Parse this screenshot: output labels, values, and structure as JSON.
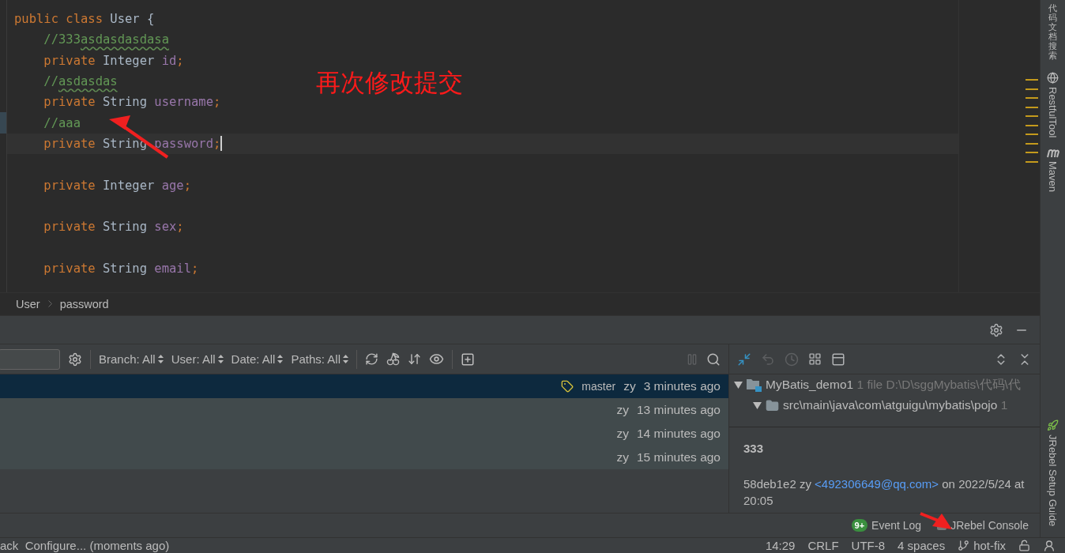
{
  "editor": {
    "lines": [
      {
        "tokens": [
          {
            "text": "public class ",
            "kind": "keyword"
          },
          {
            "text": "User {",
            "kind": "plain"
          }
        ],
        "current": false,
        "changed": false
      },
      {
        "tokens": [
          {
            "text": "    //333",
            "kind": "comment"
          },
          {
            "text": "asdasdasdasa",
            "kind": "typo"
          }
        ],
        "current": false,
        "changed": false
      },
      {
        "tokens": [
          {
            "text": "    private ",
            "kind": "keyword"
          },
          {
            "text": "Integer ",
            "kind": "plain"
          },
          {
            "text": "id",
            "kind": "field"
          },
          {
            "text": ";",
            "kind": "keyword"
          }
        ],
        "current": false,
        "changed": false
      },
      {
        "tokens": [
          {
            "text": "    //",
            "kind": "comment"
          },
          {
            "text": "asdasdas",
            "kind": "typo"
          }
        ],
        "current": false,
        "changed": false
      },
      {
        "tokens": [
          {
            "text": "    private ",
            "kind": "keyword"
          },
          {
            "text": "String ",
            "kind": "plain"
          },
          {
            "text": "username",
            "kind": "field"
          },
          {
            "text": ";",
            "kind": "keyword"
          }
        ],
        "current": false,
        "changed": false
      },
      {
        "tokens": [
          {
            "text": "    //aaa",
            "kind": "comment"
          }
        ],
        "current": false,
        "changed": true
      },
      {
        "tokens": [
          {
            "text": "    private ",
            "kind": "keyword"
          },
          {
            "text": "String ",
            "kind": "plain"
          },
          {
            "text": "password",
            "kind": "field"
          },
          {
            "text": ";",
            "kind": "keyword"
          }
        ],
        "current": true,
        "changed": false
      },
      {
        "current": false,
        "changed": false
      },
      {
        "tokens": [
          {
            "text": "    private ",
            "kind": "keyword"
          },
          {
            "text": "Integer ",
            "kind": "plain"
          },
          {
            "text": "age",
            "kind": "field"
          },
          {
            "text": ";",
            "kind": "keyword"
          }
        ],
        "current": false,
        "changed": false
      },
      {
        "current": false,
        "changed": false
      },
      {
        "tokens": [
          {
            "text": "    private ",
            "kind": "keyword"
          },
          {
            "text": "String ",
            "kind": "plain"
          },
          {
            "text": "sex",
            "kind": "field"
          },
          {
            "text": ";",
            "kind": "keyword"
          }
        ],
        "current": false,
        "changed": false
      },
      {
        "current": false,
        "changed": false
      },
      {
        "tokens": [
          {
            "text": "    private ",
            "kind": "keyword"
          },
          {
            "text": "String ",
            "kind": "plain"
          },
          {
            "text": "email",
            "kind": "field"
          },
          {
            "text": ";",
            "kind": "keyword"
          }
        ],
        "current": false,
        "changed": false
      }
    ]
  },
  "annotation": "再次修改提交",
  "breadcrumb": [
    "User",
    "password"
  ],
  "log_filters": [
    "Branch: All",
    "User: All",
    "Date: All",
    "Paths: All"
  ],
  "commits": [
    {
      "branch": "master",
      "author": "zy",
      "date": "3 minutes ago",
      "selected": true
    },
    {
      "author": "zy",
      "date": "13 minutes ago",
      "selected": false
    },
    {
      "author": "zy",
      "date": "14 minutes ago",
      "selected": false
    },
    {
      "author": "zy",
      "date": "15 minutes ago",
      "selected": false
    }
  ],
  "changes_tree": [
    {
      "name": "MyBatis_demo1",
      "detail": "1 file  D:\\D\\sggMybatis\\代码\\代",
      "kind": "module",
      "children": [
        {
          "name": "src\\main\\java\\com\\atguigu\\mybatis\\pojo",
          "detail": "1",
          "kind": "folder"
        }
      ]
    }
  ],
  "commit_details": {
    "message": "333",
    "prefix": "58deb1e2 zy",
    "email": "<492306649@qq.com>",
    "suffix": "on 2022/5/24 at 20:05"
  },
  "tool_buttons": [
    {
      "label": "Event Log",
      "badge": "9+",
      "kind": "log"
    },
    {
      "label": "JRebel Console",
      "kind": "jrebel"
    }
  ],
  "status_bar": {
    "message": "ack  Configure... (moments ago)",
    "items": [
      "14:29",
      "CRLF",
      "UTF-8",
      "4 spaces"
    ],
    "branch": "hot-fix"
  },
  "right_stripe": {
    "top": [
      {
        "label": "代码文档搜索",
        "kind": "cjk"
      },
      {
        "label": "RestfulTool",
        "kind": "globe"
      },
      {
        "label": "Maven",
        "kind": "maven"
      }
    ],
    "bottom": [
      {
        "label": "JRebel Setup Guide",
        "kind": "jrebel"
      }
    ]
  }
}
